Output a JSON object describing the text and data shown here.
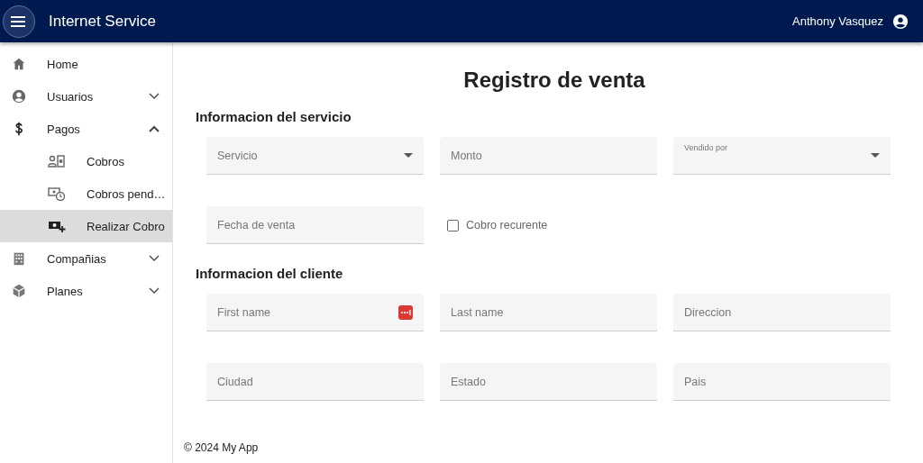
{
  "app_bar": {
    "title": "Internet Service",
    "user": "Anthony Vasquez"
  },
  "sidebar": {
    "items": [
      {
        "label": "Home",
        "selected": false
      },
      {
        "label": "Usuarios",
        "selected": false,
        "expanded": false
      },
      {
        "label": "Pagos",
        "selected": false,
        "expanded": true,
        "children": [
          {
            "label": "Cobros",
            "selected": false
          },
          {
            "label": "Cobros pend…",
            "selected": false
          },
          {
            "label": "Realizar Cobro",
            "selected": true
          }
        ]
      },
      {
        "label": "Compañias",
        "selected": false,
        "expanded": false
      },
      {
        "label": "Planes",
        "selected": false,
        "expanded": false
      }
    ]
  },
  "page_title": "Registro de venta",
  "sections": [
    {
      "title": "Informacion del servicio",
      "fields": [
        {
          "kind": "select",
          "label": "Servicio",
          "label_raised": false
        },
        {
          "kind": "text",
          "label": "Monto",
          "label_raised": false
        },
        {
          "kind": "select",
          "label": "Vendido por",
          "label_raised": true
        },
        {
          "kind": "text",
          "label": "Fecha de venta",
          "label_raised": false
        },
        {
          "kind": "checkbox",
          "label": "Cobro recurente",
          "checked": false
        }
      ]
    },
    {
      "title": "Informacion del cliente",
      "fields": [
        {
          "kind": "text",
          "label": "First name",
          "label_raised": false,
          "autofill_icon": true
        },
        {
          "kind": "text",
          "label": "Last name",
          "label_raised": false
        },
        {
          "kind": "text",
          "label": "Direccion",
          "label_raised": false
        },
        {
          "kind": "text",
          "label": "Ciudad",
          "label_raised": false
        },
        {
          "kind": "text",
          "label": "Estado",
          "label_raised": false
        },
        {
          "kind": "text",
          "label": "Pais",
          "label_raised": false
        }
      ]
    }
  ],
  "footer": "© 2024 My App"
}
